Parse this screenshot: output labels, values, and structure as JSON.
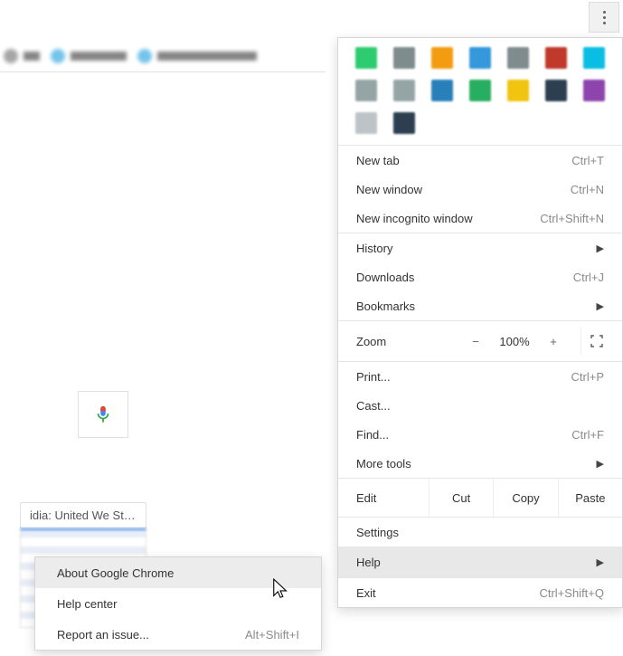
{
  "bookmarks": {
    "items": [
      {
        "color": "#777",
        "w": 18
      },
      {
        "color": "#2aa5e0",
        "w": 62
      },
      {
        "color": "#2aa5e0",
        "w": 110
      }
    ]
  },
  "pagebits": {
    "thumb_label": "idia: United We St…"
  },
  "extensions": {
    "colors": [
      "#2ecc71",
      "#7f8c8d",
      "#f39c12",
      "#3498db",
      "#7f8c8d",
      "#c0392b",
      "#0abde3",
      "#95a5a6",
      "#95a5a6",
      "#2980b9",
      "#27ae60",
      "#f1c40f",
      "#2c3e50",
      "#8e44ad",
      "#bdc3c7",
      "#2c3e50"
    ]
  },
  "menu": {
    "new_tab": {
      "label": "New tab",
      "shortcut": "Ctrl+T"
    },
    "new_window": {
      "label": "New window",
      "shortcut": "Ctrl+N"
    },
    "new_incognito": {
      "label": "New incognito window",
      "shortcut": "Ctrl+Shift+N"
    },
    "history": {
      "label": "History"
    },
    "downloads": {
      "label": "Downloads",
      "shortcut": "Ctrl+J"
    },
    "bookmarks": {
      "label": "Bookmarks"
    },
    "zoom": {
      "label": "Zoom",
      "value": "100%",
      "minus": "−",
      "plus": "+"
    },
    "print": {
      "label": "Print...",
      "shortcut": "Ctrl+P"
    },
    "cast": {
      "label": "Cast..."
    },
    "find": {
      "label": "Find...",
      "shortcut": "Ctrl+F"
    },
    "more_tools": {
      "label": "More tools"
    },
    "edit": {
      "label": "Edit",
      "cut": "Cut",
      "copy": "Copy",
      "paste": "Paste"
    },
    "settings": {
      "label": "Settings"
    },
    "help": {
      "label": "Help"
    },
    "exit": {
      "label": "Exit",
      "shortcut": "Ctrl+Shift+Q"
    }
  },
  "submenu": {
    "about": {
      "label": "About Google Chrome"
    },
    "help_center": {
      "label": "Help center"
    },
    "report": {
      "label": "Report an issue...",
      "shortcut": "Alt+Shift+I"
    }
  }
}
